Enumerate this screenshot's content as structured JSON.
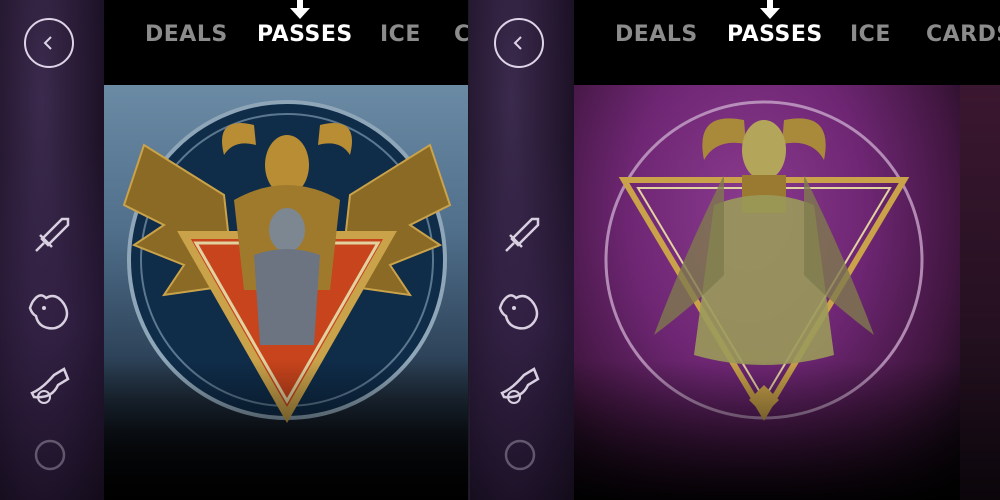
{
  "panels": [
    {
      "id": "left",
      "tabs": [
        "DEALS",
        "PASSES",
        "ICE",
        "C"
      ],
      "active_tab": "PASSES",
      "artwork": "winged-demon-pass-emblem",
      "sidebar_icons": [
        "sword-icon",
        "ghost-icon",
        "horn-icon",
        "ring-icon"
      ]
    },
    {
      "id": "right",
      "tabs": [
        "DEALS",
        "PASSES",
        "ICE",
        "CARDS"
      ],
      "active_tab": "PASSES",
      "artwork": "satyr-panpipes-pass-emblem",
      "sidebar_icons": [
        "sword-icon",
        "ghost-icon",
        "horn-icon",
        "ring-icon"
      ]
    }
  ],
  "colors": {
    "active_tab": "#ffffff",
    "inactive_tab": "#8c8c8c",
    "gold": "#c9a24a",
    "blue_bg": "#506f8b",
    "purple_bg": "#6e2673"
  }
}
